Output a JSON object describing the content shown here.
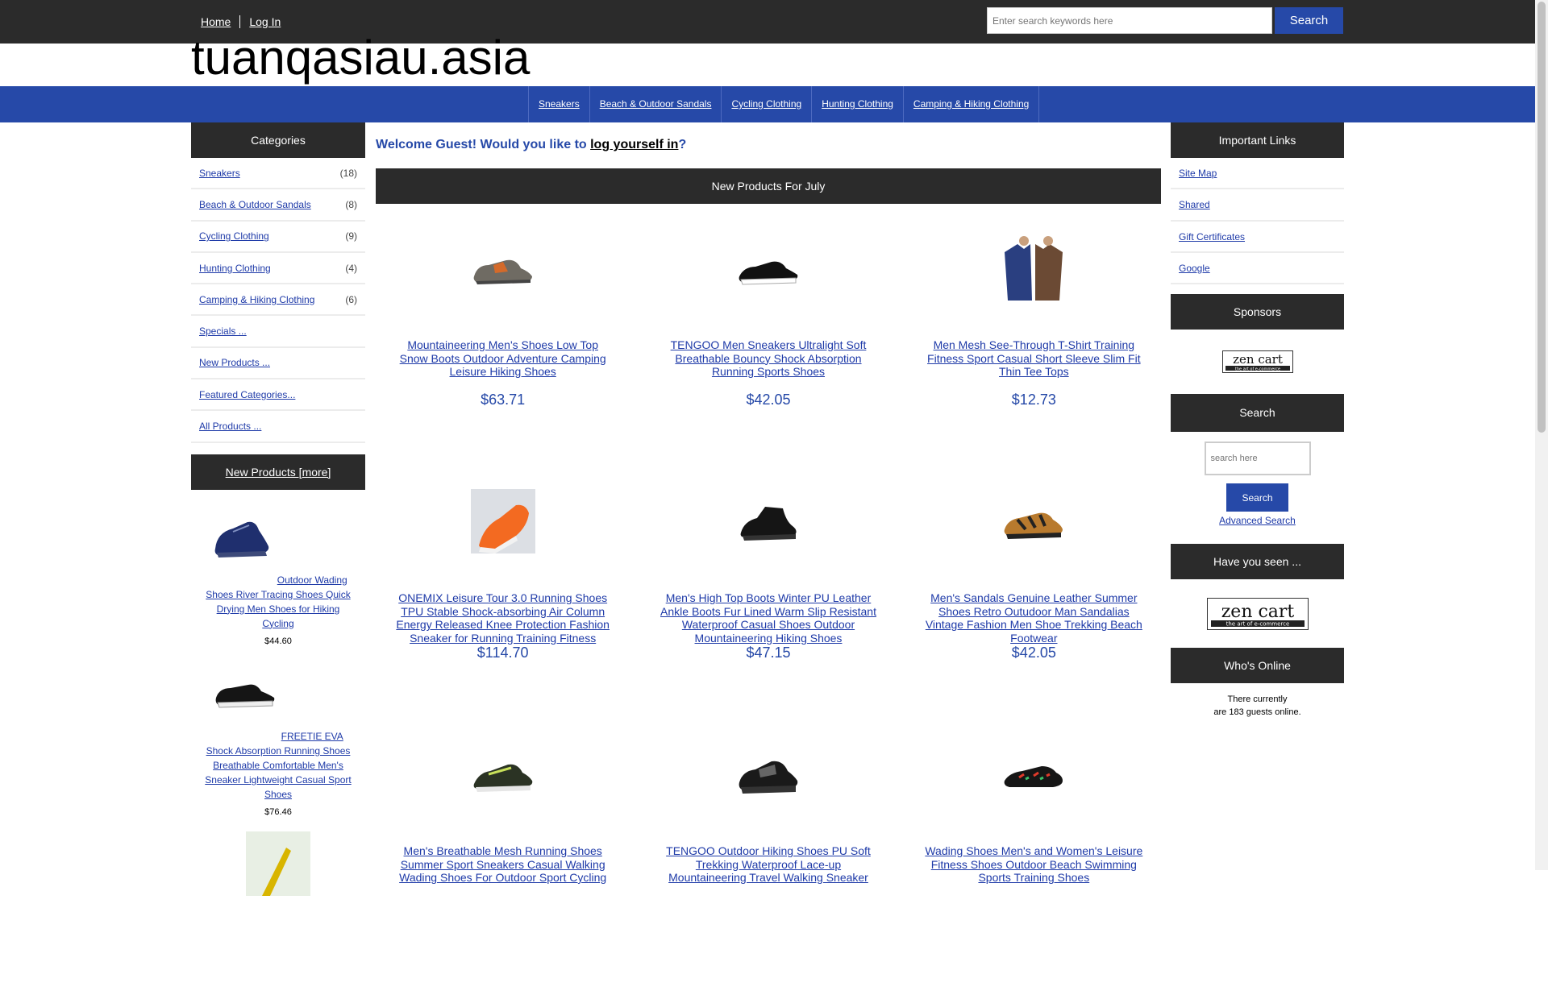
{
  "header": {
    "nav": [
      "Home",
      "Log In"
    ],
    "search_placeholder": "Enter search keywords here",
    "search_button": "Search",
    "site_name": "tuanqasiau.asia"
  },
  "categories_bar": [
    "Sneakers",
    "Beach & Outdoor Sandals",
    "Cycling Clothing",
    "Hunting Clothing",
    "Camping & Hiking Clothing"
  ],
  "left": {
    "categories_title": "Categories",
    "categories": [
      {
        "label": "Sneakers",
        "count": "(18)"
      },
      {
        "label": "Beach & Outdoor Sandals",
        "count": "(8)"
      },
      {
        "label": "Cycling Clothing",
        "count": "(9)"
      },
      {
        "label": "Hunting Clothing",
        "count": "(4)"
      },
      {
        "label": "Camping & Hiking Clothing",
        "count": "(6)"
      }
    ],
    "links": [
      "Specials ...",
      "New Products ...",
      "Featured Categories...",
      "All Products ..."
    ],
    "new_products_title": "New Products  [more]",
    "new_products": [
      {
        "name": "Outdoor Wading Shoes River Tracing Shoes Quick Drying Men Shoes for Hiking Cycling",
        "price": "$44.60"
      },
      {
        "name": "FREETIE EVA Shock Absorption Running Shoes Breathable Comfortable Men's Sneaker Lightweight Casual Sport Shoes",
        "price": "$76.46"
      }
    ]
  },
  "center": {
    "welcome_prefix": "Welcome Guest! Would you like to ",
    "welcome_link": "log yourself in",
    "welcome_suffix": "?",
    "section_title": "New Products For July",
    "products": [
      {
        "name": "Mountaineering Men's Shoes Low Top Snow Boots Outdoor Adventure Camping Leisure Hiking Shoes",
        "price": "$63.71"
      },
      {
        "name": "TENGOO Men Sneakers Ultralight Soft Breathable Bouncy Shock Absorption Running Sports Shoes",
        "price": "$42.05"
      },
      {
        "name": "Men Mesh See-Through T-Shirt Training Fitness Sport Casual Short Sleeve Slim Fit Thin Tee Tops",
        "price": "$12.73"
      },
      {
        "name": "ONEMIX Leisure Tour 3.0 Running Shoes TPU Stable Shock-absorbing Air Column Energy Released Knee Protection Fashion Sneaker for Running Training Fitness",
        "price": "$114.70"
      },
      {
        "name": "Men's High Top Boots Winter PU Leather Ankle Boots Fur Lined Warm Slip Resistant Waterproof Casual Shoes Outdoor Mountaineering Hiking Shoes",
        "price": "$47.15"
      },
      {
        "name": "Men's Sandals Genuine Leather Summer Shoes Retro Outudoor Man Sandalias Vintage Fashion Men Shoe Trekking Beach Footwear",
        "price": "$42.05"
      },
      {
        "name": "Men's Breathable Mesh Running Shoes Summer Sport Sneakers Casual Walking Wading Shoes For Outdoor Sport Cycling",
        "price": ""
      },
      {
        "name": "TENGOO Outdoor Hiking Shoes PU Soft Trekking Waterproof Lace-up Mountaineering Travel Walking Sneaker",
        "price": ""
      },
      {
        "name": "Wading Shoes Men's and Women's Leisure Fitness Shoes Outdoor Beach Swimming Sports Training Shoes",
        "price": ""
      }
    ]
  },
  "right": {
    "links_title": "Important Links",
    "links": [
      "Site Map",
      "Shared",
      "Gift Certificates",
      "Google"
    ],
    "sponsors_title": "Sponsors",
    "sponsor_logo": "zen cart the art of e-commerce",
    "search_title": "Search",
    "search_placeholder": "search here",
    "search_button": "Search",
    "advanced_search": "Advanced Search",
    "haveseen_title": "Have you seen ...",
    "whos_online_title": "Who's Online",
    "online_line1": "There currently",
    "online_line2": "are 183 guests online."
  },
  "colors": {
    "nav_blue": "#2649a8",
    "dark_header": "#2b2b2b",
    "link_blue": "#1e3aa8"
  }
}
